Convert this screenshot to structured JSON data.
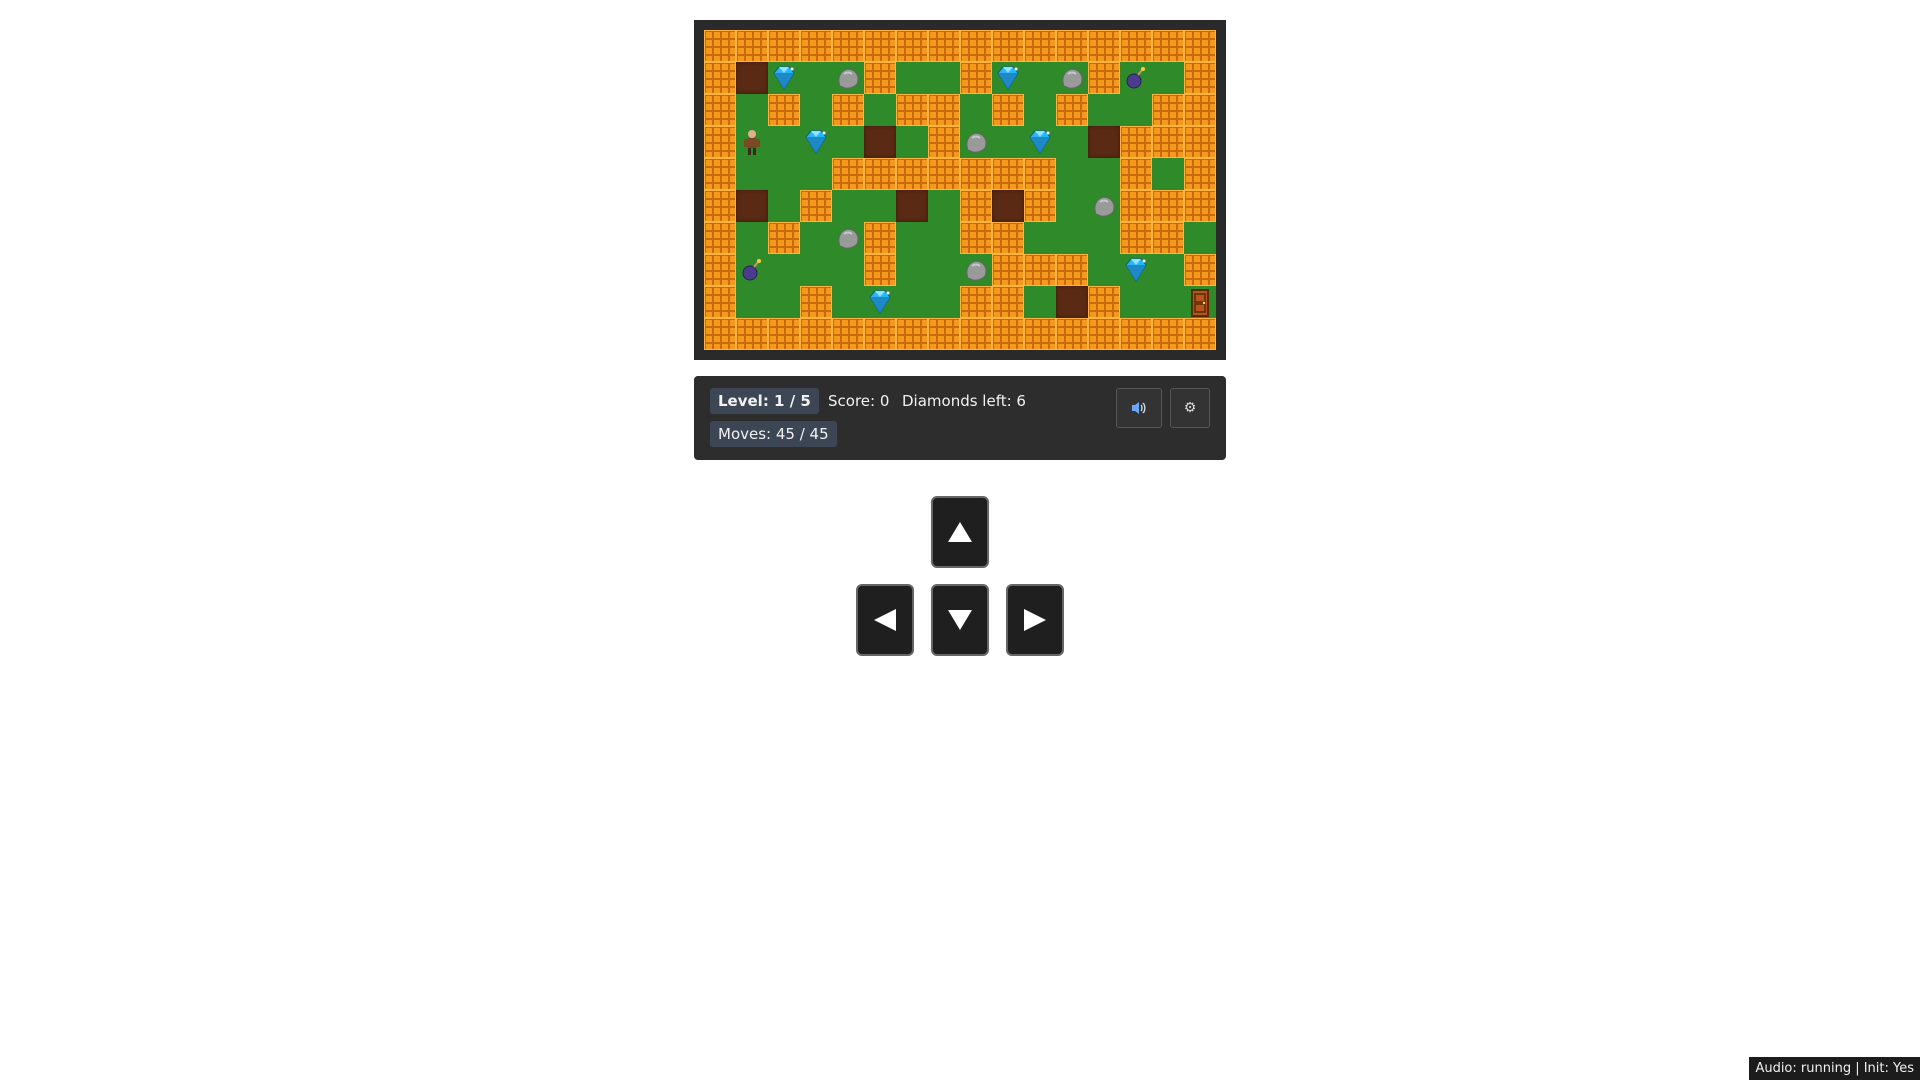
{
  "board": {
    "cols": 16,
    "rows": 10,
    "grid": [
      "################",
      "#.D.R#..#D.R#B.#",
      "#.#.#.##.#.#..##",
      "#P.D...#R.D..###",
      "#...#######..#.#",
      "#..#....#.#.R###",
      "#.#.R#..##...##.",
      "#B...#..R###.D.#",
      "#..#.D..##..#..E",
      "################"
    ],
    "legend": {
      "#": "brick-wall",
      ".": "grass-floor",
      "D": "diamond",
      "R": "boulder",
      "B": "bomb",
      "P": "player",
      "E": "exit-door"
    }
  },
  "hud": {
    "level": "Level: 1 / 5",
    "score": "Score: 0",
    "diamonds_left": "Diamonds left: 6",
    "moves": "Moves: 45 / 45",
    "sound_icon": "speaker-icon",
    "settings_icon": "gear-icon"
  },
  "controls": {
    "up": "▲",
    "left": "◀",
    "down": "▼",
    "right": "▶"
  },
  "status": {
    "text": "Audio: running | Init: Yes"
  },
  "colors": {
    "wall": "#f39a1c",
    "floor": "#2f8a2a",
    "dirt": "#5a2a14",
    "frame": "#2a2a2a",
    "hud_bg": "#2d2d2d",
    "diamond": "#29b6f6"
  }
}
